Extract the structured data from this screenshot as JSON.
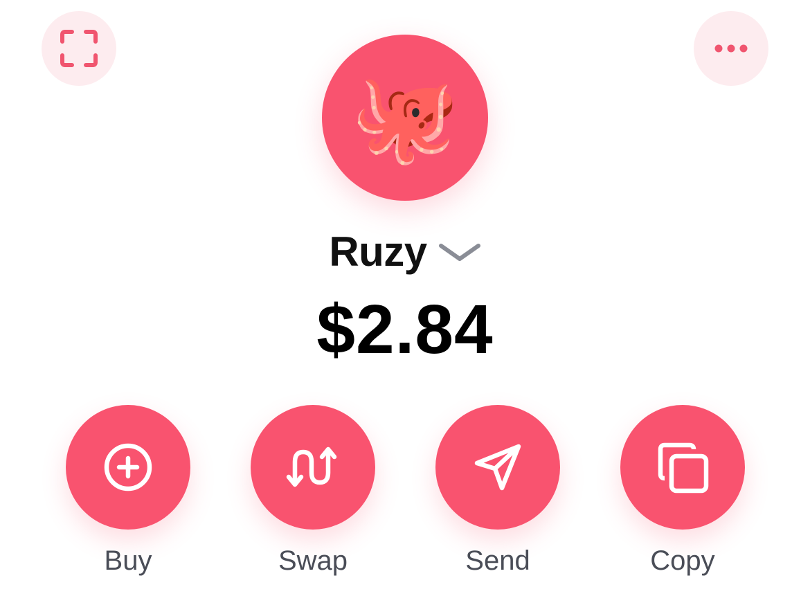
{
  "header": {
    "scan_icon": "scan-qr-icon",
    "more_icon": "more-horizontal-icon"
  },
  "avatar": {
    "emoji": "🐙",
    "background": "#f9536f"
  },
  "account": {
    "name": "Ruzy",
    "chevron_icon": "chevron-down-icon"
  },
  "balance": {
    "amount": "$2.84"
  },
  "actions": [
    {
      "label": "Buy",
      "icon": "plus-circle-icon"
    },
    {
      "label": "Swap",
      "icon": "swap-arrows-icon"
    },
    {
      "label": "Send",
      "icon": "send-arrow-icon"
    },
    {
      "label": "Copy",
      "icon": "copy-icon"
    }
  ],
  "colors": {
    "accent": "#f9536f",
    "accent_light": "#fdecef",
    "label_gray": "#4a4d57",
    "chevron_gray": "#8a8d96"
  }
}
